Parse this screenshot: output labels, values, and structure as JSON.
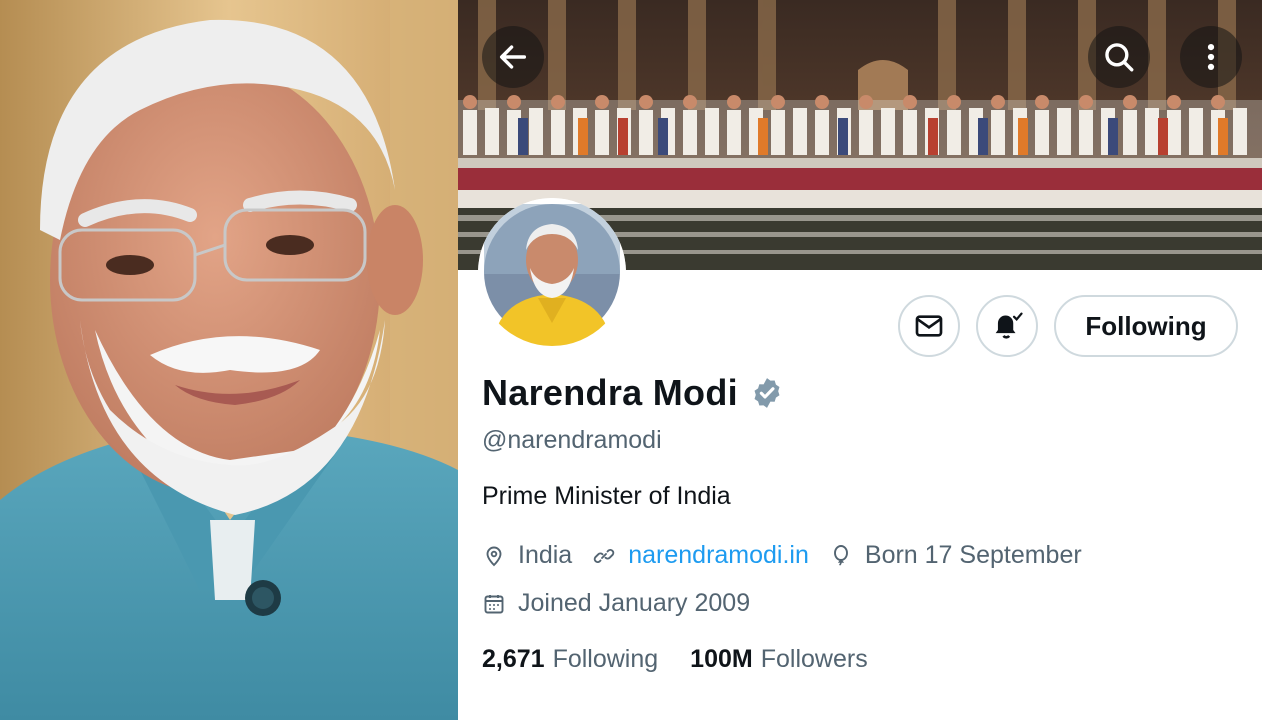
{
  "profile": {
    "display_name": "Narendra Modi",
    "verified_badge": "verified-badge-icon",
    "handle": "@narendramodi",
    "bio": "Prime Minister of India",
    "location": "India",
    "website": "narendramodi.in",
    "birthday": "Born 17 September",
    "joined": "Joined January 2009",
    "following_count": "2,671",
    "following_label": "Following",
    "followers_count": "100M",
    "followers_label": "Followers"
  },
  "header": {
    "back_icon": "arrow-left-icon",
    "search_icon": "search-icon",
    "more_icon": "more-vertical-icon"
  },
  "actions": {
    "message_icon": "mail-icon",
    "notify_icon": "bell-check-icon",
    "following_label": "Following"
  },
  "colors": {
    "link": "#1d9bf0",
    "badge": "#829aab",
    "secondary_text": "#536471",
    "primary_text": "#0f1419",
    "jacket": "#4d9bb3"
  }
}
